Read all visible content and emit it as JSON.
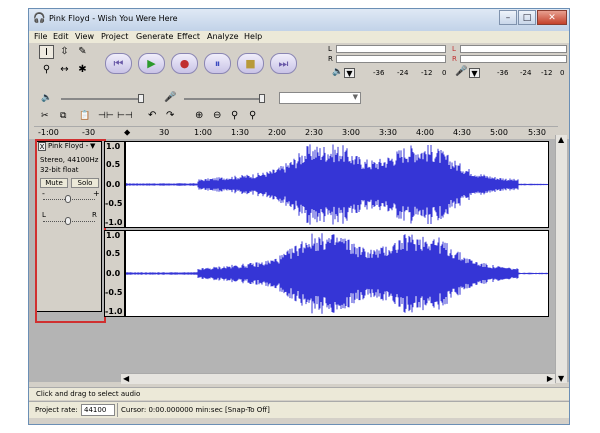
{
  "window": {
    "title": "Pink Floyd - Wish You Were Here"
  },
  "menu": [
    {
      "label": "File"
    },
    {
      "label": "Edit"
    },
    {
      "label": "View"
    },
    {
      "label": "Project"
    },
    {
      "label": "Generate"
    },
    {
      "label": "Effect"
    },
    {
      "label": "Analyze"
    },
    {
      "label": "Help"
    }
  ],
  "meters": {
    "playback_l": "L",
    "playback_r": "R",
    "record_l": "L",
    "record_r": "R",
    "ticks_left": [
      "-36",
      "-24",
      "-12",
      "0"
    ],
    "ticks_right": [
      "-36",
      "-24",
      "-12",
      "0"
    ]
  },
  "ruler": {
    "labels": [
      "-1:00",
      "-30",
      "30",
      "1:00",
      "1:30",
      "2:00",
      "2:30",
      "3:00",
      "3:30",
      "4:00",
      "4:30",
      "5:00",
      "5:30"
    ],
    "values_sec": [
      -60,
      -30,
      30,
      60,
      90,
      120,
      150,
      180,
      210,
      240,
      270,
      300,
      330
    ]
  },
  "track": {
    "name": "Pink Floyd -",
    "close": "X",
    "dropdown": "▼",
    "format": "Stereo, 44100Hz",
    "bitdepth": "32-bit float",
    "mute": "Mute",
    "solo": "Solo",
    "gain_minus": "-",
    "gain_plus": "+",
    "pan_l": "L",
    "pan_r": "R",
    "vruler_labels": [
      "1.0",
      "0.5",
      "0.0",
      "-0.5",
      "-1.0"
    ]
  },
  "status": {
    "hint": "Click and drag to select audio",
    "rate_label": "Project rate:",
    "rate_value": "44100",
    "cursor": "Cursor: 0:00.000000 min:sec  [Snap-To Off]"
  },
  "colors": {
    "wave": "#3535d6",
    "highlight": "#d03030",
    "selected_play": "#3aa43a",
    "record": "#c03030"
  },
  "icons": {
    "select_tool": "i-beam-icon",
    "envelope_tool": "envelope-icon",
    "draw_tool": "pencil-icon",
    "zoom_tool": "magnifier-icon",
    "timeshift_tool": "double-arrow-icon",
    "multi_tool": "asterisk-icon"
  }
}
